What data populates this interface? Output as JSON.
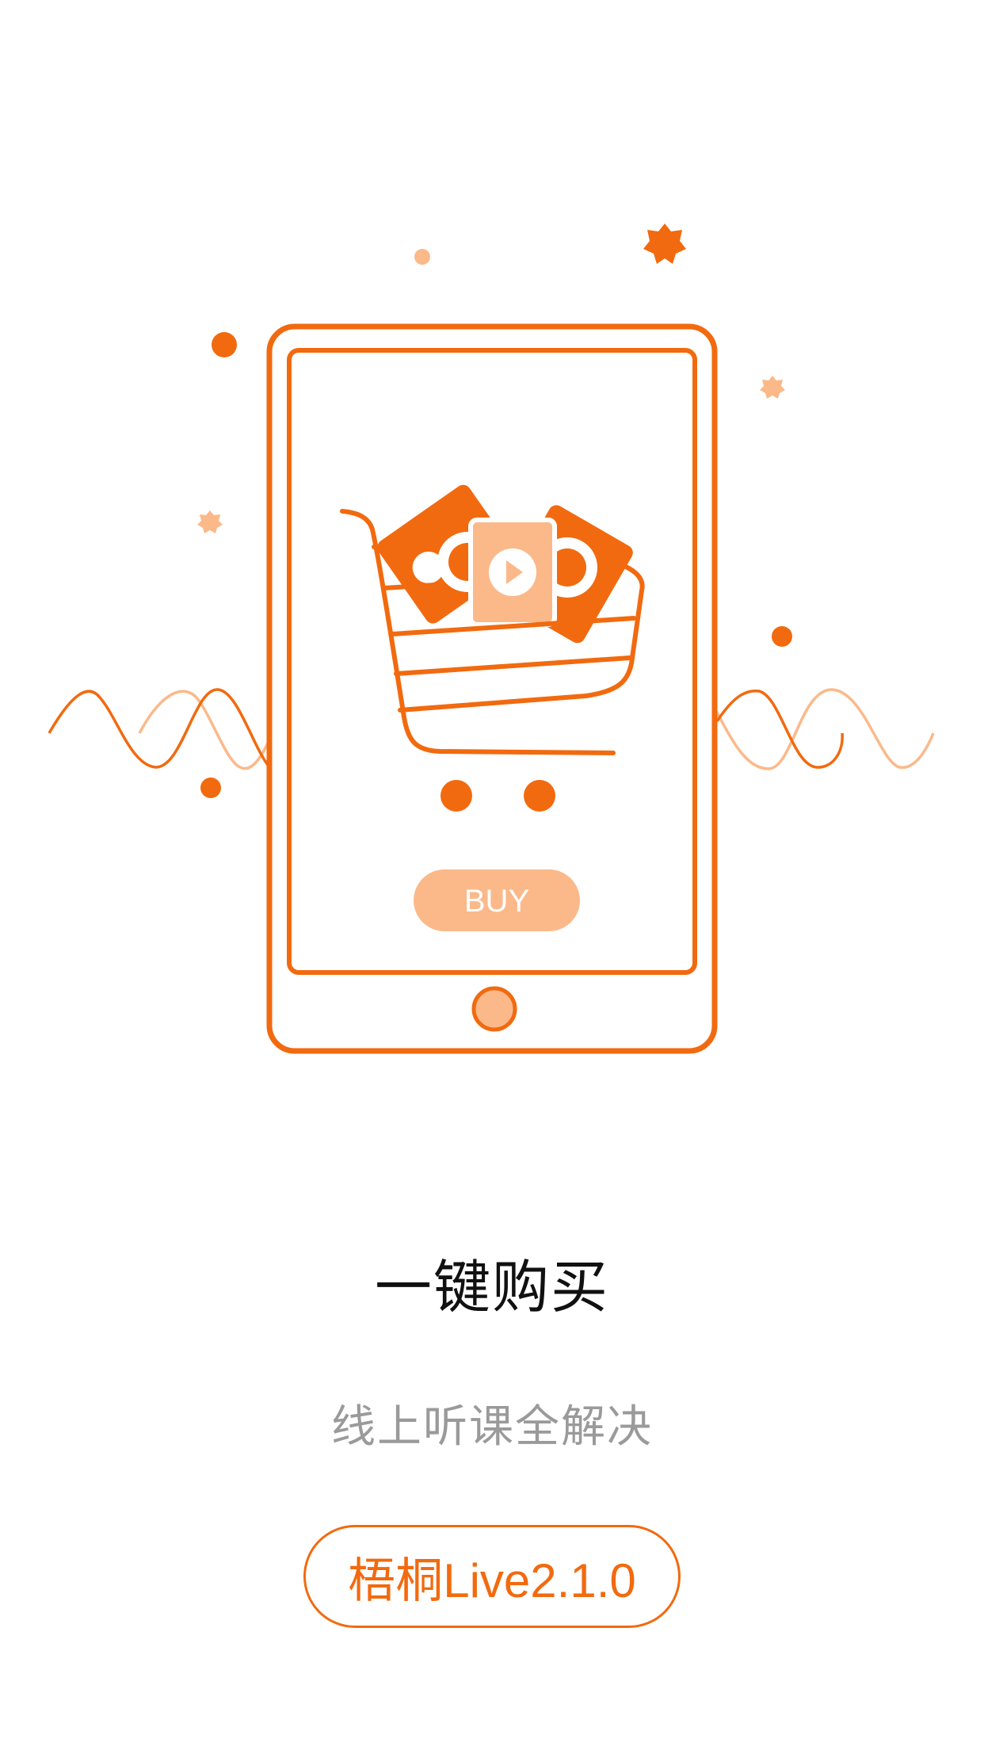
{
  "illustration": {
    "button_label": "BUY",
    "icons": [
      "phone-icon",
      "shopping-cart-icon",
      "video-card-icon",
      "play-icon",
      "sparkle-icon",
      "wave-icon"
    ]
  },
  "headline": "一键购买",
  "subline": "线上听课全解决",
  "version_label": "梧桐Live2.1.0",
  "colors": {
    "accent": "#f26a0f",
    "accent_light": "#fbb98a",
    "headline": "#111111",
    "subline": "#9a9a9a",
    "background": "#ffffff"
  }
}
